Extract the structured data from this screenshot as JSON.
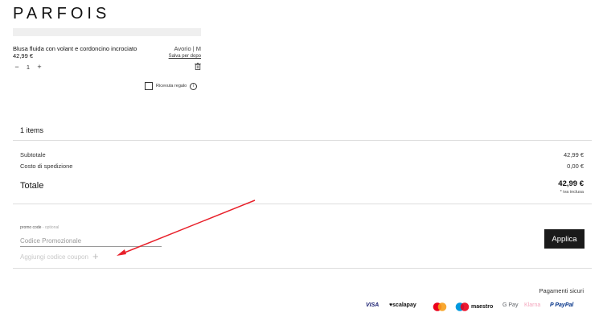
{
  "brand": {
    "logo": "PARFOIS"
  },
  "product": {
    "name": "Blusa fluida con volant e cordoncino incrociato",
    "price": "42,99 €",
    "variant": "Avorio | M",
    "save_later": "Salva per dopo",
    "quantity": "1",
    "minus": "−",
    "plus": "+",
    "gift_label": "Ricevuta regalo",
    "gift_info": "i"
  },
  "summary": {
    "items_count": "1 items",
    "subtotal_label": "Subtotale",
    "subtotal_value": "42,99 €",
    "shipping_label": "Costo di spedizione",
    "shipping_value": "0,00 €",
    "total_label": "Totale",
    "total_value": "42,99 €",
    "vat_note": "* iva inclusa"
  },
  "promo": {
    "label": "promo code",
    "optional": "- optional",
    "placeholder": "Codice Promozionale",
    "add_coupon": "Aggiungi codice coupon",
    "add_icon": "+",
    "apply_label": "Applica"
  },
  "payments": {
    "title": "Pagamenti sicuri",
    "methods": [
      {
        "name": "VISA",
        "color": "#1a1f71"
      },
      {
        "name": "♥scalapay",
        "color": "#111111"
      },
      {
        "name": "mastercard-icon",
        "color": "#eb001b"
      },
      {
        "name": "maestro",
        "color": "#111111"
      },
      {
        "name": "G Pay",
        "color": "#5f6368"
      },
      {
        "name": "Klarna",
        "color": "#ffb3c7"
      },
      {
        "name": "PayPal",
        "color": "#003087"
      }
    ]
  },
  "annotation": {
    "arrow_color": "#e8202a"
  }
}
